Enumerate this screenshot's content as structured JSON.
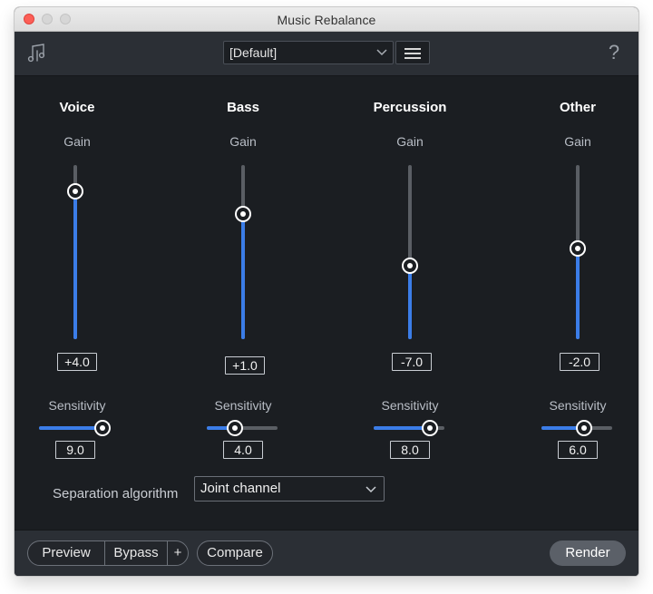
{
  "window": {
    "title": "Music Rebalance"
  },
  "toolbar": {
    "logo_icon": "music-rebalance-icon",
    "preset_value": "[Default]",
    "menu_icon": "hamburger-menu-icon",
    "help_label": "?"
  },
  "colors": {
    "accent": "#3b7de8",
    "background": "#1b1e22",
    "panel": "#2b2f35"
  },
  "channels": [
    {
      "name": "Voice",
      "gain_label": "Gain",
      "gain_value": "+4.0",
      "gain_level": 0.85,
      "sensitivity_label": "Sensitivity",
      "sensitivity_value": "9.0",
      "sensitivity_level": 0.9
    },
    {
      "name": "Bass",
      "gain_label": "Gain",
      "gain_value": "+1.0",
      "gain_level": 0.72,
      "sensitivity_label": "Sensitivity",
      "sensitivity_value": "4.0",
      "sensitivity_level": 0.4
    },
    {
      "name": "Percussion",
      "gain_label": "Gain",
      "gain_value": "-7.0",
      "gain_level": 0.42,
      "sensitivity_label": "Sensitivity",
      "sensitivity_value": "8.0",
      "sensitivity_level": 0.8
    },
    {
      "name": "Other",
      "gain_label": "Gain",
      "gain_value": "-2.0",
      "gain_level": 0.52,
      "sensitivity_label": "Sensitivity",
      "sensitivity_value": "6.0",
      "sensitivity_level": 0.6
    }
  ],
  "separation": {
    "label": "Separation algorithm",
    "value": "Joint channel"
  },
  "footer": {
    "preview_label": "Preview",
    "bypass_label": "Bypass",
    "plus_label": "+",
    "compare_label": "Compare",
    "render_label": "Render"
  }
}
